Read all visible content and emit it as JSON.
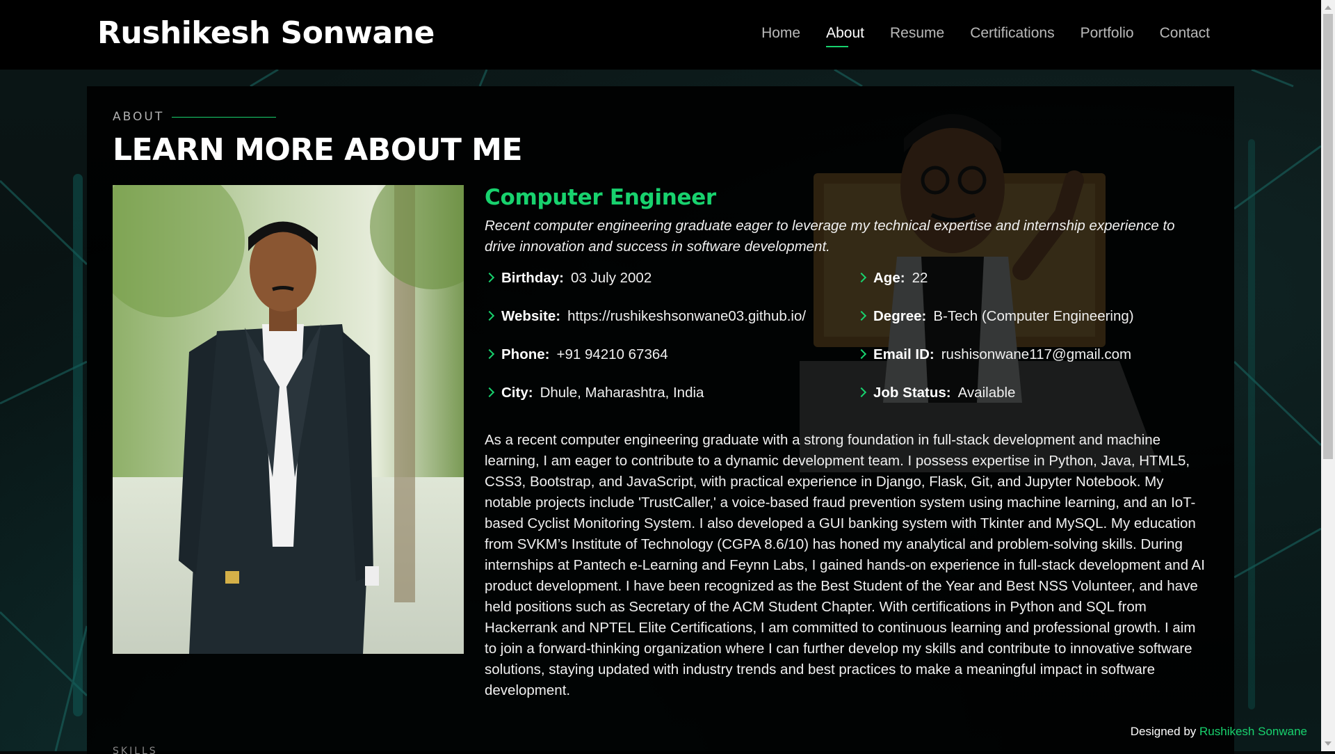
{
  "header": {
    "site_title": "Rushikesh Sonwane",
    "nav": [
      {
        "label": "Home",
        "active": false
      },
      {
        "label": "About",
        "active": true
      },
      {
        "label": "Resume",
        "active": false
      },
      {
        "label": "Certifications",
        "active": false
      },
      {
        "label": "Portfolio",
        "active": false
      },
      {
        "label": "Contact",
        "active": false
      }
    ]
  },
  "about": {
    "section_label": "ABOUT",
    "section_title": "LEARN MORE ABOUT ME",
    "role_title": "Computer Engineer",
    "tagline": "Recent computer engineering graduate eager to leverage my technical expertise and internship experience to drive innovation and success in software development.",
    "facts": {
      "birthday": {
        "key": "Birthday:",
        "value": "03 July 2002"
      },
      "age": {
        "key": "Age:",
        "value": "22"
      },
      "website": {
        "key": "Website:",
        "value": "https://rushikeshsonwane03.github.io/"
      },
      "degree": {
        "key": "Degree:",
        "value": "B-Tech (Computer Engineering)"
      },
      "phone": {
        "key": "Phone:",
        "value": "+91 94210 67364"
      },
      "email": {
        "key": "Email ID:",
        "value": "rushisonwane117@gmail.com"
      },
      "city": {
        "key": "City:",
        "value": "Dhule, Maharashtra, India"
      },
      "job_status": {
        "key": "Job Status:",
        "value": "Available"
      }
    },
    "bio": "As a recent computer engineering graduate with a strong foundation in full-stack development and machine learning, I am eager to contribute to a dynamic development team. I possess expertise in Python, Java, HTML5, CSS3, Bootstrap, and JavaScript, with practical experience in Django, Flask, Git, and Jupyter Notebook. My notable projects include 'TrustCaller,' a voice-based fraud prevention system using machine learning, and an IoT-based Cyclist Monitoring System. I also developed a GUI banking system with Tkinter and MySQL. My education from SVKM’s Institute of Technology (CGPA 8.6/10) has honed my analytical and problem-solving skills. During internships at Pantech e-Learning and Feynn Labs, I gained hands-on experience in full-stack development and AI product development. I have been recognized as the Best Student of the Year and Best NSS Volunteer, and have held positions such as Secretary of the ACM Student Chapter. With certifications in Python and SQL from Hackerrank and NPTEL Elite Certifications, I am committed to continuous learning and professional growth. I aim to join a forward-thinking organization where I can further develop my skills and contribute to innovative software solutions, staying updated with industry trends and best practices to make a meaningful impact in software development.",
    "skills_peek": "SKILLS"
  },
  "footer": {
    "prefix": "Designed by",
    "author": "Rushikesh Sonwane"
  },
  "colors": {
    "accent": "#18d26e",
    "header_bg": "#000000",
    "panel_bg": "#000000"
  }
}
